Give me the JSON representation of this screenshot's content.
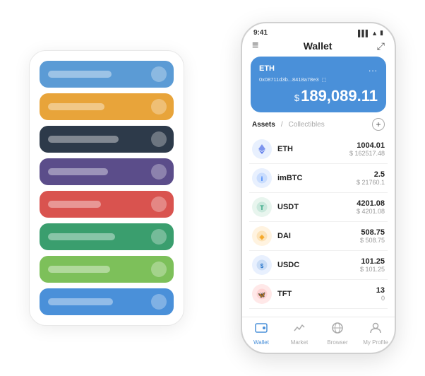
{
  "scene": {
    "background": "#ffffff"
  },
  "cardStack": {
    "cards": [
      {
        "id": "card-blue",
        "colorClass": "card-blue",
        "barWidth": "90px"
      },
      {
        "id": "card-orange",
        "colorClass": "card-orange",
        "barWidth": "80px"
      },
      {
        "id": "card-dark",
        "colorClass": "card-dark",
        "barWidth": "100px"
      },
      {
        "id": "card-purple",
        "colorClass": "card-purple",
        "barWidth": "85px"
      },
      {
        "id": "card-red",
        "colorClass": "card-red",
        "barWidth": "75px"
      },
      {
        "id": "card-green-dark",
        "colorClass": "card-green-dark",
        "barWidth": "95px"
      },
      {
        "id": "card-green-light",
        "colorClass": "card-green-light",
        "barWidth": "88px"
      },
      {
        "id": "card-blue-light",
        "colorClass": "card-blue-light",
        "barWidth": "92px"
      }
    ]
  },
  "phone": {
    "status": {
      "time": "9:41",
      "signal": "●●●",
      "wifi": "WiFi",
      "battery": "🔋"
    },
    "header": {
      "menu_icon": "≡",
      "title": "Wallet",
      "expand_icon": "⤢"
    },
    "eth_card": {
      "label": "ETH",
      "more_icon": "...",
      "address": "0x08711d3b...8418a78e3",
      "address_suffix": "⬚",
      "balance_symbol": "$",
      "balance": "189,089.11"
    },
    "assets_section": {
      "tab_active": "Assets",
      "separator": "/",
      "tab_inactive": "Collectibles",
      "add_icon": "+"
    },
    "assets": [
      {
        "id": "eth",
        "icon": "◈",
        "icon_class": "asset-icon-eth",
        "name": "ETH",
        "amount": "1004.01",
        "usd": "$ 162517.48"
      },
      {
        "id": "imbtc",
        "icon": "⊕",
        "icon_class": "asset-icon-imbtc",
        "name": "imBTC",
        "amount": "2.5",
        "usd": "$ 21760.1"
      },
      {
        "id": "usdt",
        "icon": "ⓣ",
        "icon_class": "asset-icon-usdt",
        "name": "USDT",
        "amount": "4201.08",
        "usd": "$ 4201.08"
      },
      {
        "id": "dai",
        "icon": "⊛",
        "icon_class": "asset-icon-dai",
        "name": "DAI",
        "amount": "508.75",
        "usd": "$ 508.75"
      },
      {
        "id": "usdc",
        "icon": "Ⓢ",
        "icon_class": "asset-icon-usdc",
        "name": "USDC",
        "amount": "101.25",
        "usd": "$ 101.25"
      },
      {
        "id": "tft",
        "icon": "🦋",
        "icon_class": "asset-icon-tft",
        "name": "TFT",
        "amount": "13",
        "usd": "0"
      }
    ],
    "nav": [
      {
        "id": "wallet",
        "icon": "◎",
        "label": "Wallet",
        "active": true
      },
      {
        "id": "market",
        "icon": "📈",
        "label": "Market",
        "active": false
      },
      {
        "id": "browser",
        "icon": "🌐",
        "label": "Browser",
        "active": false
      },
      {
        "id": "profile",
        "icon": "👤",
        "label": "My Profile",
        "active": false
      }
    ]
  }
}
